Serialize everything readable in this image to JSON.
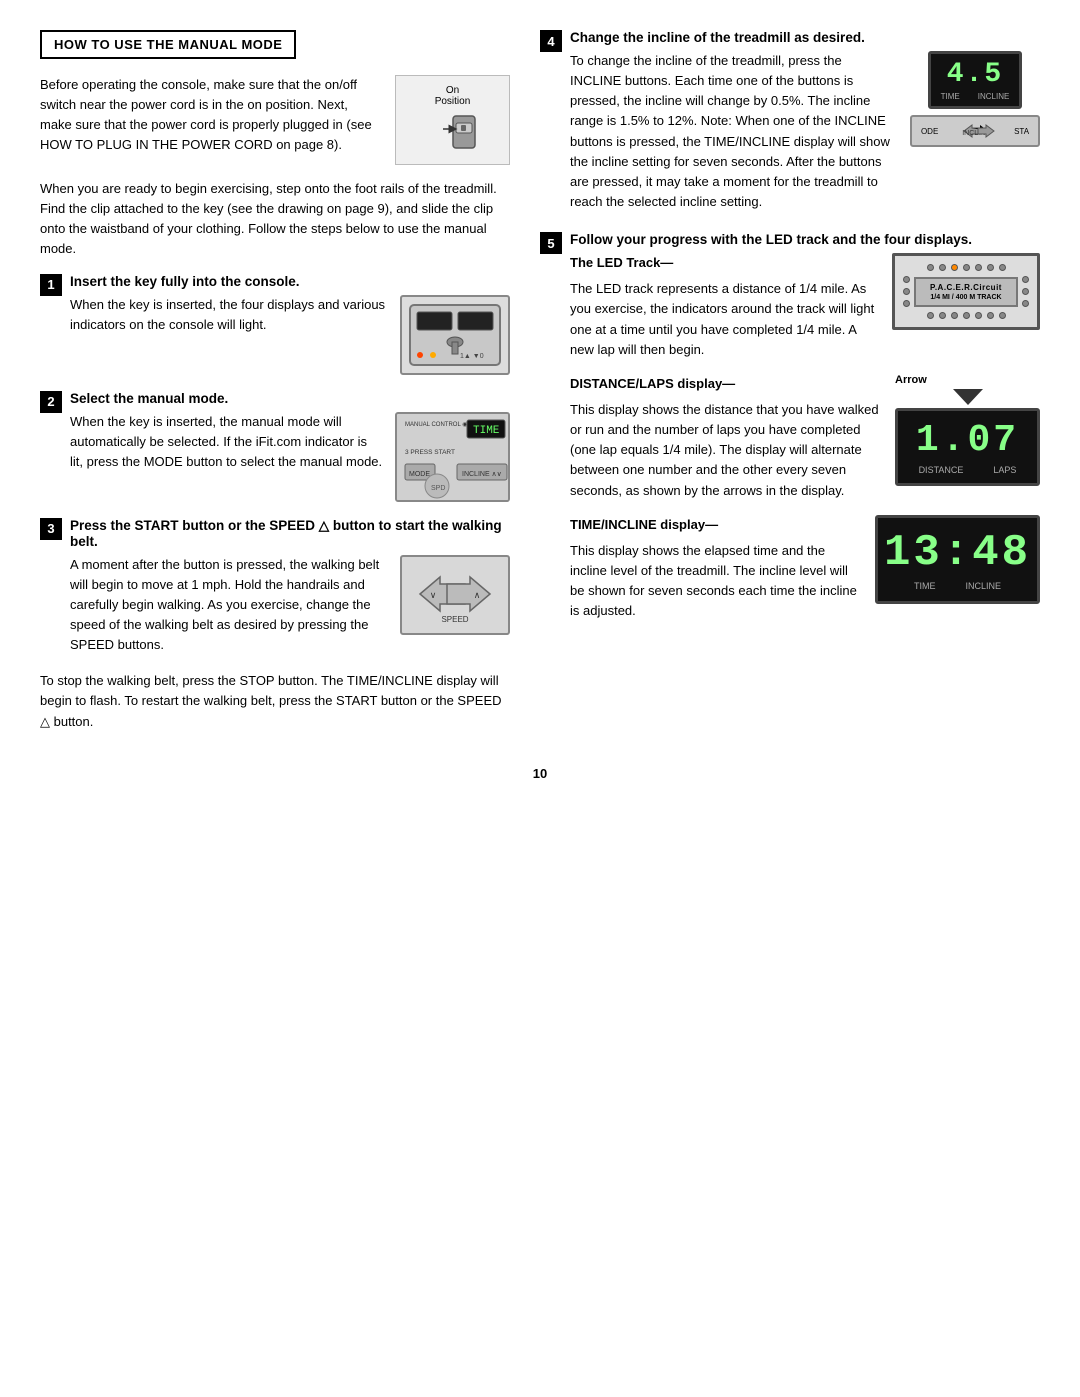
{
  "page": {
    "number": "10",
    "left_section_title": "HOW TO USE THE MANUAL MODE",
    "right_section_step_number": "4",
    "right_section_step_title": "Change the incline of the treadmill as desired."
  },
  "left_column": {
    "intro_para1": "Before operating the console, make sure that the on/off switch near the power cord is in the on position. Next, make sure that the power cord is properly plugged in (see HOW TO PLUG IN THE POWER CORD on page 8).",
    "switch_label": "On\nPosition",
    "intro_para2": "When you are ready to begin exercising, step onto the foot rails of the treadmill. Find the clip attached to the key (see the drawing on page 9), and slide the clip onto the waistband of your clothing. Follow the steps below to use the manual mode.",
    "step1": {
      "number": "1",
      "title": "Insert the key fully into the console.",
      "text": "When the key is inserted, the four displays and various indicators on the console will light."
    },
    "step2": {
      "number": "2",
      "title": "Select the manual mode.",
      "text": "When the key is inserted, the manual mode will automatically be selected. If the iFit.com indicator is lit, press the MODE button to select the manual mode.",
      "console_labels": [
        "MANUAL CONTROL",
        "TIME",
        "MODE",
        "3 PRESS START"
      ]
    },
    "step3": {
      "number": "3",
      "title": "Press the START button or the SPEED △ button to start the walking belt.",
      "text": "A moment after the button is pressed, the walking belt will begin to move at 1 mph. Hold the handrails and carefully begin walking. As you exercise, change the speed of the walking belt as desired by pressing the SPEED buttons.",
      "speed_label": "SPEED"
    },
    "stop_para": "To stop the walking belt, press the STOP button. The TIME/INCLINE display will begin to flash. To restart the walking belt, press the START button or the SPEED △ button."
  },
  "right_column": {
    "step4": {
      "text1": "To change the incline of the treadmill, press the INCLINE buttons. Each time one of the buttons is pressed, the incline will change by 0.5%. The incline range is 1.5% to 12%. Note: When one of the INCLINE buttons is pressed, the TIME/INCLINE display will show the incline setting for seven seconds. After the buttons are pressed, it may take a moment for the treadmill to reach the selected incline setting.",
      "display_value": "4.5",
      "display_labels": [
        "TIME",
        "INCLINE"
      ],
      "console_labels": [
        "ODE",
        "INCLINE",
        "STA"
      ]
    },
    "step5": {
      "number": "5",
      "title": "Follow your progress with the LED track and the four displays.",
      "led_track": {
        "subtitle": "The LED Track—",
        "text": "The LED track represents a distance of 1/4 mile. As you exercise, the indicators around the track will light one at a time until you have completed 1/4 mile. A new lap will then begin.",
        "center_label": "P.A.C.E.R.Circuit",
        "sub_label": "1/4 MI / 400 M TRACK"
      },
      "distance": {
        "subtitle": "DISTANCE/LAPS display—",
        "text": "This display shows the distance that you have walked or run and the number of laps you have completed (one lap equals 1/4 mile). The display will alternate between one number and the other every seven seconds, as shown by the arrows in the display.",
        "value": "1.07",
        "arrow_label": "Arrow",
        "labels": [
          "DISTANCE",
          "LAPS"
        ]
      },
      "time_incline": {
        "subtitle": "TIME/INCLINE display—",
        "text": "This display shows the elapsed time and the incline level of the treadmill. The incline level will be shown for seven seconds each time the incline is adjusted.",
        "value": "13:48",
        "labels": [
          "TIME",
          "INCLINE"
        ]
      }
    }
  }
}
